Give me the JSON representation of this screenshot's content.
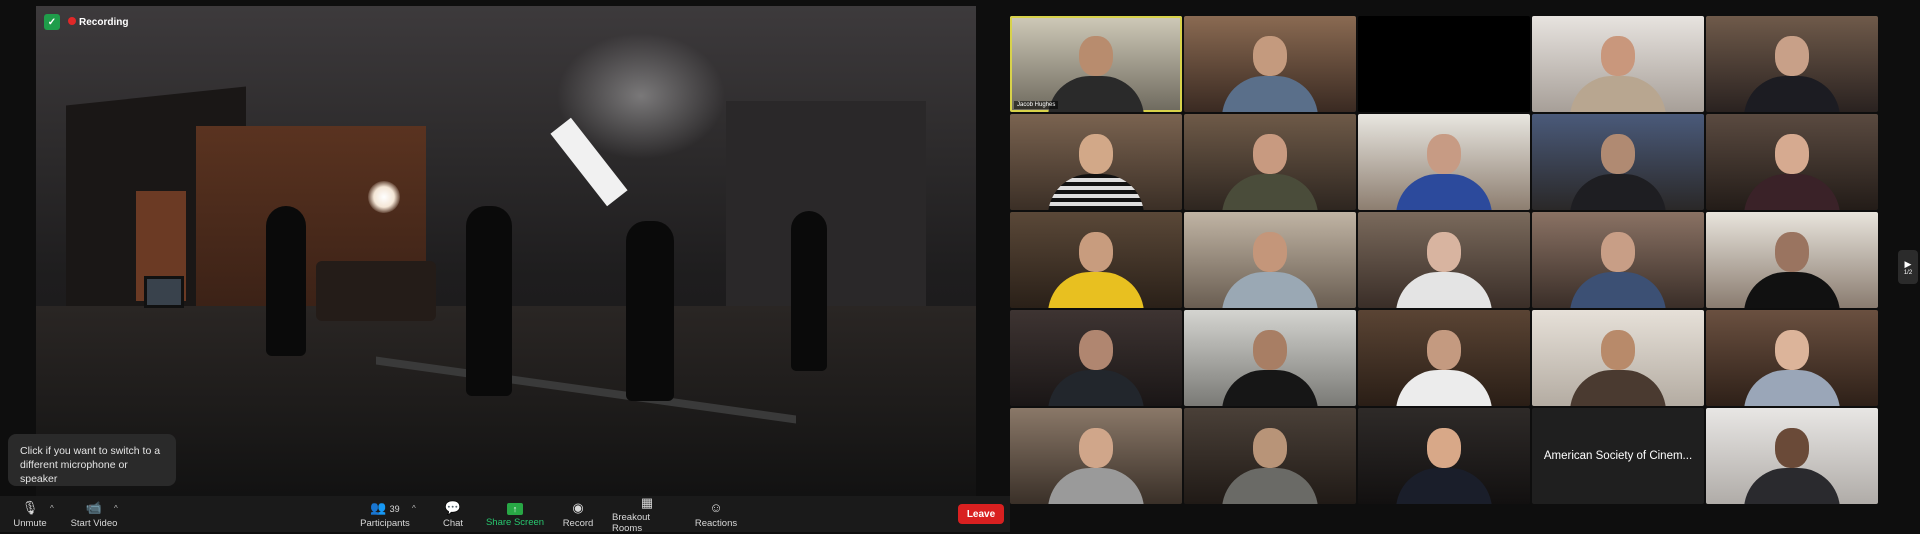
{
  "recording": {
    "label": "Recording"
  },
  "tooltip": {
    "text": "Click if you want to switch to a different microphone or speaker"
  },
  "toolbar": {
    "unmute": "Unmute",
    "start_video": "Start Video",
    "participants_label": "Participants",
    "participants_count": "39",
    "chat": "Chat",
    "share_screen": "Share Screen",
    "record": "Record",
    "breakout_rooms": "Breakout Rooms",
    "reactions": "Reactions",
    "leave": "Leave"
  },
  "gallery": {
    "active_tile_name": "Jacob Hughes",
    "text_tile_label": "American Society of Cinem...",
    "page_indicator": "1/2"
  },
  "colors": {
    "leave": "#d92020",
    "share_screen": "#28c76f",
    "active_speaker_outline": "#d8d24a",
    "recording_dot": "#e02828"
  }
}
